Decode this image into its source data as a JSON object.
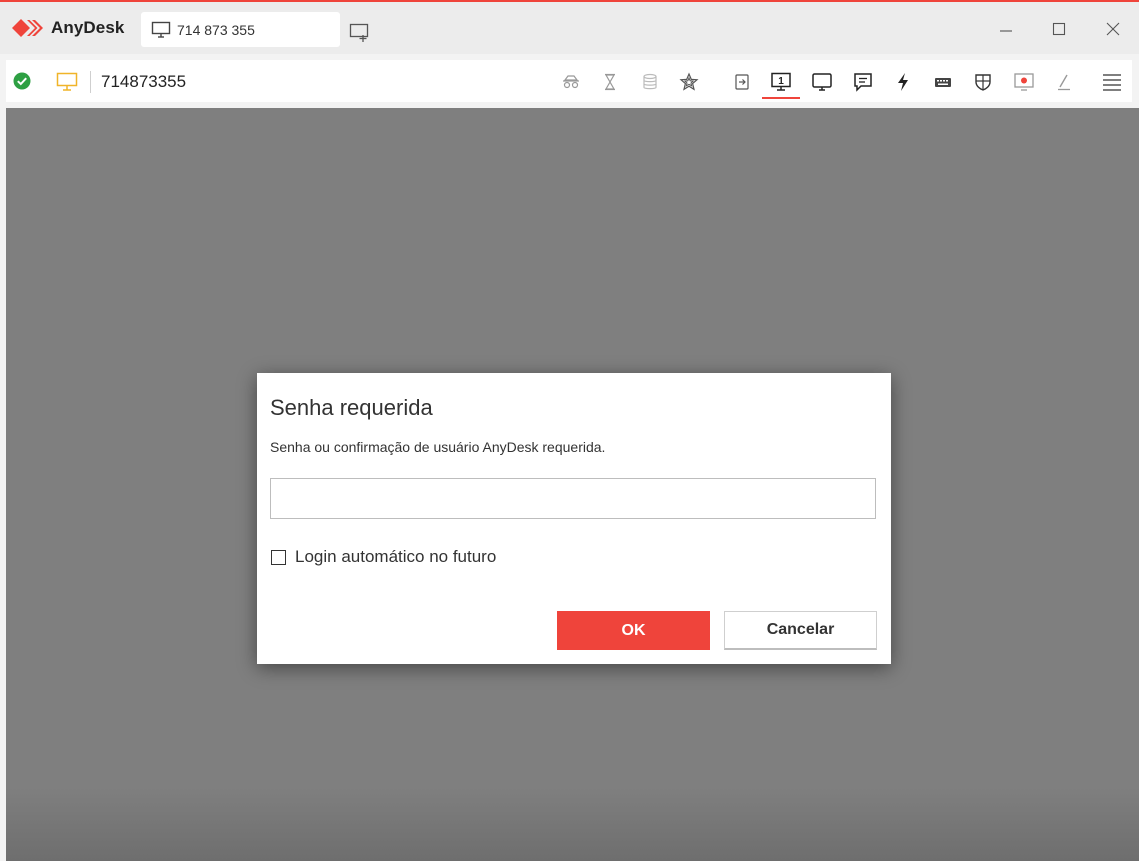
{
  "app": {
    "name": "AnyDesk",
    "brand_color": "#ef443b"
  },
  "tab": {
    "label": "714 873 355",
    "icon": "monitor-icon"
  },
  "new_tab_icon": "new-tab-icon",
  "window_controls": {
    "minimize_icon": "minimize-icon",
    "maximize_icon": "maximize-icon",
    "close_icon": "close-icon"
  },
  "toolbar": {
    "status_icon": "check-circle-icon",
    "status_color": "#2ea043",
    "remote_icon": "monitor-icon",
    "remote_icon_color": "#f0b429",
    "remote_id": "714873355",
    "tools": [
      "privacy-icon",
      "hourglass-icon",
      "database-icon",
      "star-icon",
      "file-transfer-icon",
      "display-1-icon",
      "monitor-icon",
      "chat-icon",
      "actions-bolt-icon",
      "keyboard-icon",
      "permissions-shield-icon",
      "record-icon",
      "whiteboard-pen-icon",
      "menu-icon"
    ]
  },
  "dialog": {
    "title": "Senha requerida",
    "message": "Senha ou confirmação de usuário AnyDesk requerida.",
    "password_value": "",
    "password_placeholder": "",
    "auto_login_label": "Login automático no futuro",
    "auto_login_checked": false,
    "ok_label": "OK",
    "cancel_label": "Cancelar"
  }
}
